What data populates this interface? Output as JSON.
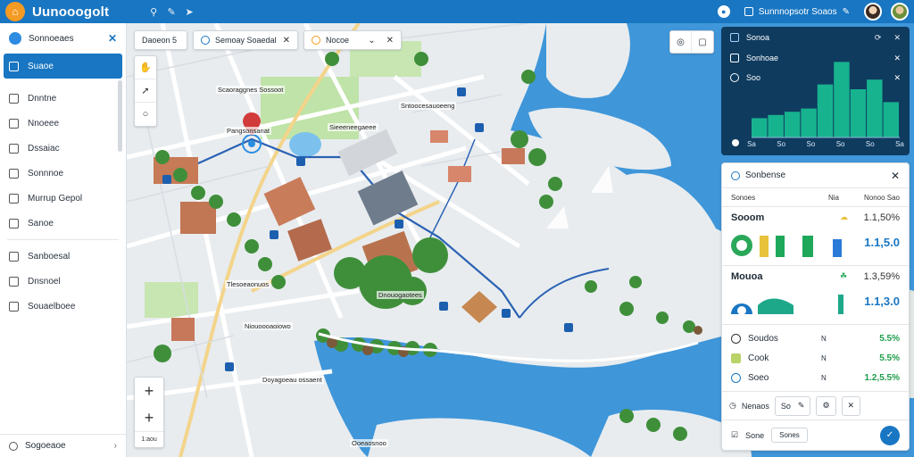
{
  "app": {
    "title": "Uunooogolt",
    "logo_glyph": "⌂",
    "header_chip": "Sunnnopsotr Soaos",
    "toolbar_icons": [
      "search-icon",
      "pencil-icon",
      "pin-icon"
    ]
  },
  "sidebar": {
    "header": "Sonnoeaes",
    "items": [
      {
        "label": "Suaoe",
        "active": true
      },
      {
        "label": "Dnntne"
      },
      {
        "label": "Nnoeee"
      },
      {
        "label": "Dssaiac"
      },
      {
        "label": "Sonnnoe"
      },
      {
        "label": "Murrup Gepol"
      },
      {
        "label": "Sanoe"
      },
      {
        "label": "Sanboesal"
      },
      {
        "label": "Dnsnoel"
      },
      {
        "label": "Souaelboee"
      }
    ],
    "footer": "Sogoeaoe"
  },
  "map": {
    "chips": [
      {
        "label": "Daoeon 5"
      },
      {
        "label": "Semoay Soaedal"
      },
      {
        "label": "Nocoe"
      }
    ],
    "zoom_in": "+",
    "zoom_out": "+",
    "scale": "1:aou",
    "labels": [
      "Scaoraggnes Sossoot",
      "Pangsonsanat",
      "Sieeeneegaeee",
      "Sntoocesauoeeng",
      "Tlesoeaonuos",
      "Dnouogaotees",
      "Niouoooaoiowo",
      "Doyagoeau ossaent",
      "Ooeaosnoo"
    ]
  },
  "chart_card": {
    "title": "Sonoa",
    "row1": "Sonhoae",
    "row2": "Soo",
    "x_labels": [
      "Sa",
      "So",
      "So",
      "So",
      "So",
      "Sa"
    ],
    "bars": [
      0.12,
      0.14,
      0.16,
      0.18,
      0.33,
      0.47,
      0.3,
      0.36,
      0.22
    ],
    "colors": {
      "bar": "#17b38f",
      "bg": "#0f3b5f"
    }
  },
  "detail_card": {
    "title": "Sonbense",
    "col1": "Sonoes",
    "col2": "Nia",
    "col3": "Nonoo Sao",
    "sec1": {
      "title": "Sooom",
      "icon": "cloud-icon",
      "value": "1.1,50%",
      "big": "1.1,5.0"
    },
    "sec2": {
      "title": "Mouoa",
      "icon": "leaf-icon",
      "value": "1.3,59%",
      "big": "1.1,3.0"
    },
    "lines": [
      {
        "label": "Soudos",
        "mid": "N",
        "value": "5.5%"
      },
      {
        "label": "Cook",
        "mid": "N",
        "value": "5.5%"
      },
      {
        "label": "Soeo",
        "mid": "N",
        "value": "1.2,5.5%"
      }
    ],
    "tools_label": "Nenaos",
    "tools_input": "So",
    "footer_label": "Sone",
    "footer_button": "Sones"
  }
}
